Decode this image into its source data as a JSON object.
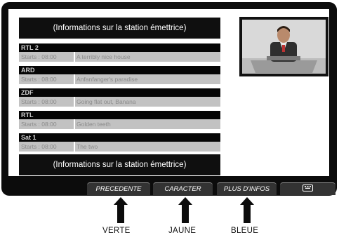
{
  "screen": {
    "info_top": "(Informations sur la station émettrice)",
    "info_bottom": "(Informations sur la station émettrice)"
  },
  "channels": [
    {
      "name": "RTL 2",
      "starts": "Starts : 08:00",
      "title": "A terribly nice house"
    },
    {
      "name": "ARD",
      "starts": "Starts : 08:00",
      "title": "Anfanfanger's paradise"
    },
    {
      "name": "ZDF",
      "starts": "Starts : 08:00",
      "title": "Going flat out, Banana"
    },
    {
      "name": "RTL",
      "starts": "Starts : 08:00",
      "title": "Golden teeth"
    },
    {
      "name": "Sat 1",
      "starts": "Starts : 08:00",
      "title": "The two"
    }
  ],
  "softkeys": {
    "previous": "PRECEDENTE",
    "character": "CARACTER",
    "more_info": "PLUS D'INFOS",
    "keyboard_icon": "keyboard-icon"
  },
  "labels": {
    "green": "VERTE",
    "yellow": "JAUNE",
    "blue": "BLEUE"
  },
  "colors": {
    "frame": "#0c0c0c",
    "channel_row": "#c2c2c2",
    "softkey": "#333333"
  }
}
